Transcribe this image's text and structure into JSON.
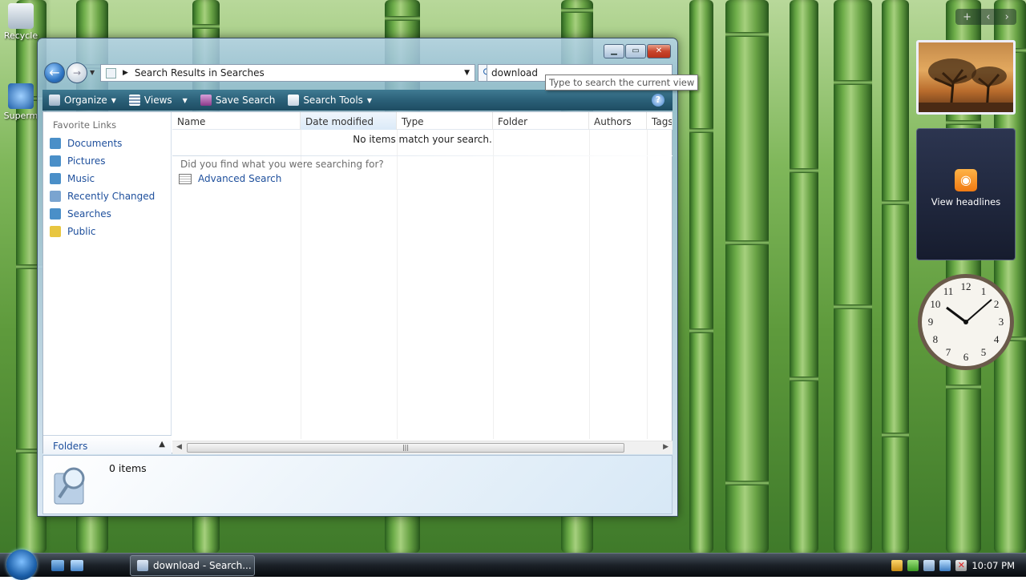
{
  "desktop": {
    "icons": [
      {
        "label": "Recycle"
      },
      {
        "label": "Superm"
      }
    ]
  },
  "window": {
    "address": "Search Results in Searches",
    "search_value": "download",
    "tooltip": "Type to search the current view",
    "toolbar": {
      "organize": "Organize",
      "views": "Views",
      "save_search": "Save Search",
      "search_tools": "Search Tools",
      "help": "?"
    },
    "nav": {
      "title": "Favorite Links",
      "items": [
        {
          "label": "Documents",
          "color": "#4a8fc8"
        },
        {
          "label": "Pictures",
          "color": "#4a8fc8"
        },
        {
          "label": "Music",
          "color": "#4a8fc8"
        },
        {
          "label": "Recently Changed",
          "color": "#7aa4d0"
        },
        {
          "label": "Searches",
          "color": "#4a8fc8"
        },
        {
          "label": "Public",
          "color": "#e8c640"
        }
      ],
      "folders": "Folders"
    },
    "columns": [
      "Name",
      "Date modified",
      "Type",
      "Folder",
      "Authors",
      "Tags"
    ],
    "empty_message": "No items match your search.",
    "did_you_find": "Did you find what you were searching for?",
    "advanced_search": "Advanced Search",
    "details": {
      "count": "0 items"
    }
  },
  "gadgets": {
    "add": "+",
    "feed_label": "View headlines",
    "clock_numbers": [
      "12",
      "1",
      "2",
      "3",
      "4",
      "5",
      "6",
      "7",
      "8",
      "9",
      "10",
      "11"
    ]
  },
  "taskbar": {
    "task": "download - Search...",
    "time": "10:07 PM"
  }
}
